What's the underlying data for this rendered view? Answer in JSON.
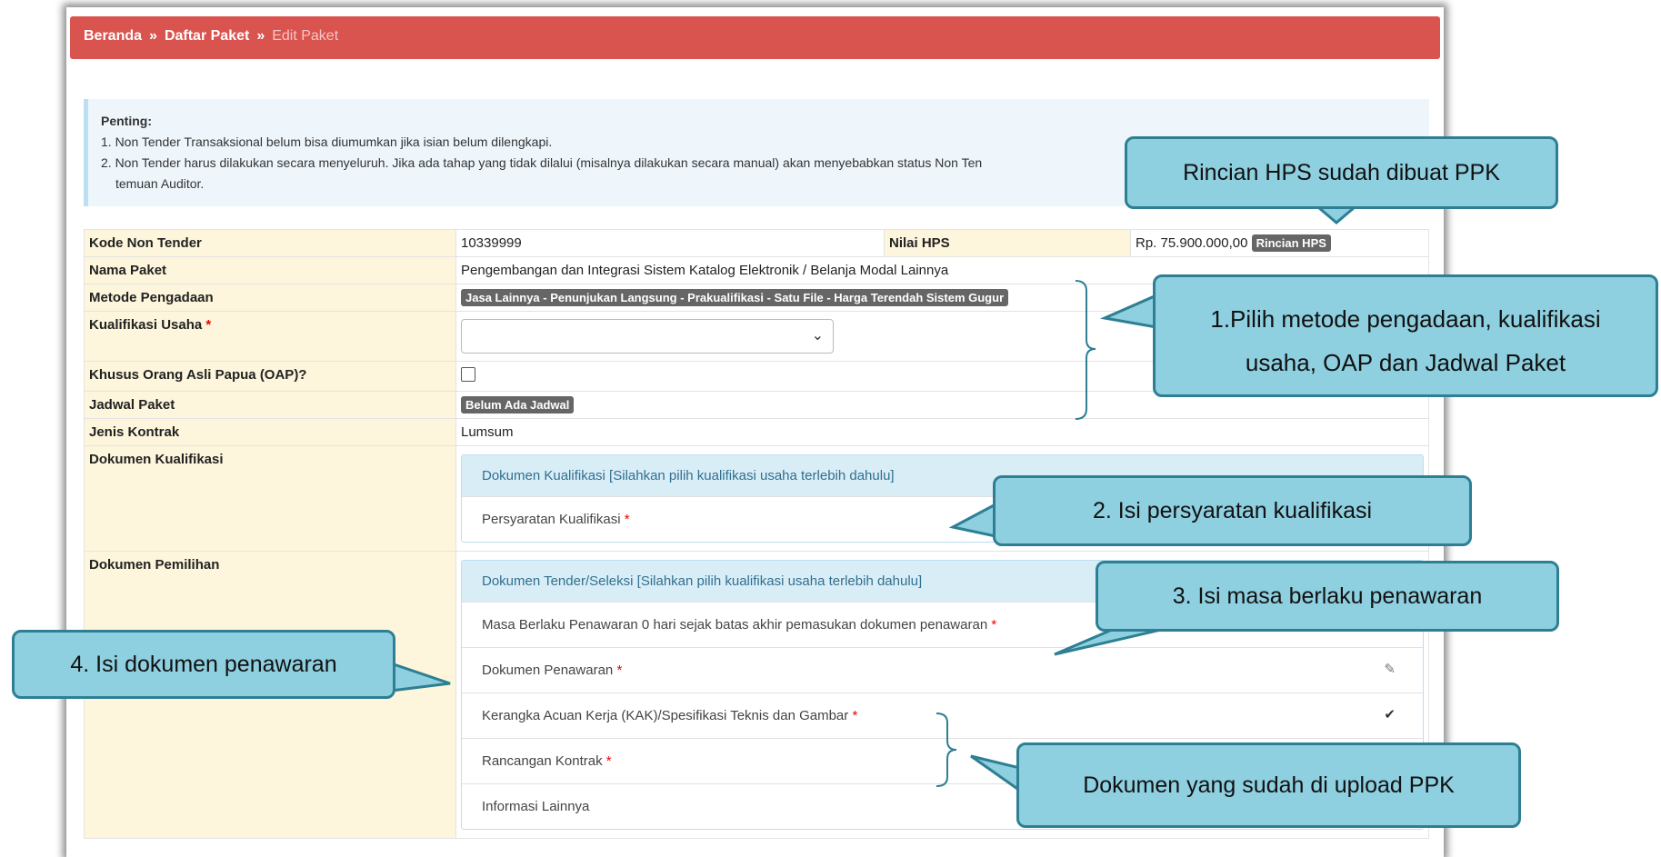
{
  "breadcrumb": {
    "home": "Beranda",
    "sep": "»",
    "list": "Daftar Paket",
    "current": "Edit Paket"
  },
  "notice": {
    "title": "Penting:",
    "line1": "1. Non Tender Transaksional belum bisa diumumkan jika isian belum dilengkapi.",
    "line2": "2. Non Tender harus dilakukan secara menyeluruh. Jika ada tahap yang tidak dilalui (misalnya dilakukan secara manual) akan menyebabkan status Non Ten",
    "line3": "temuan Auditor."
  },
  "fields": {
    "kode_label": "Kode Non Tender",
    "kode_value": "10339999",
    "hps_label": "Nilai HPS",
    "hps_value": "Rp. 75.900.000,00",
    "hps_button": "Rincian HPS",
    "nama_label": "Nama Paket",
    "nama_value": "Pengembangan dan Integrasi Sistem Katalog Elektronik / Belanja Modal Lainnya",
    "metode_label": "Metode Pengadaan",
    "metode_value": "Jasa Lainnya - Penunjukan Langsung - Prakualifikasi - Satu File - Harga Terendah Sistem Gugur",
    "kualifikasi_label": "Kualifikasi Usaha",
    "required_mark": "*",
    "oap_label": "Khusus Orang Asli Papua (OAP)?",
    "jadwal_label": "Jadwal Paket",
    "jadwal_value": "Belum Ada Jadwal",
    "kontrak_label": "Jenis Kontrak",
    "kontrak_value": "Lumsum",
    "dok_kual_label": "Dokumen Kualifikasi",
    "dok_pem_label": "Dokumen Pemilihan"
  },
  "dok_kualifikasi": {
    "header": "Dokumen Kualifikasi [Silahkan pilih kualifikasi usaha terlebih dahulu]",
    "item": "Persyaratan Kualifikasi"
  },
  "dok_pemilihan": {
    "header": "Dokumen Tender/Seleksi [Silahkan pilih kualifikasi usaha terlebih dahulu]",
    "items": [
      "Masa Berlaku Penawaran 0 hari sejak batas akhir pemasukan dokumen penawaran",
      "Dokumen Penawaran",
      "Kerangka Acuan Kerja (KAK)/Spesifikasi Teknis dan Gambar",
      "Rancangan Kontrak",
      "Informasi Lainnya"
    ]
  },
  "callouts": {
    "hps": "Rincian HPS sudah dibuat PPK",
    "step1_line1": "1.Pilih metode pengadaan, kualifikasi",
    "step1_line2": "usaha, OAP dan Jadwal Paket",
    "step2": "2. Isi  persyaratan kualifikasi",
    "step3": "3. Isi  masa berlaku penawaran",
    "step4": "4. Isi  dokumen penawaran",
    "uploaded": "Dokumen yang sudah di upload PPK"
  },
  "colors": {
    "breadcrumb_bg": "#d9534f",
    "callout_bg": "#8ecfe0",
    "callout_border": "#2e7f93"
  }
}
